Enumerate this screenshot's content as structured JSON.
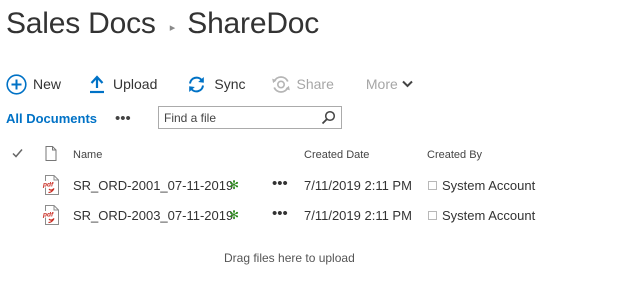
{
  "breadcrumb": {
    "site": "Sales Docs",
    "separator": "▸",
    "library": "ShareDoc"
  },
  "toolbar": {
    "new_label": "New",
    "upload_label": "Upload",
    "sync_label": "Sync",
    "share_label": "Share",
    "more_label": "More",
    "icons": [
      "plus-circle-icon",
      "upload-arrow-icon",
      "sync-icon",
      "share-icon",
      "chevron-down-icon"
    ],
    "accent_color": "#0072c6",
    "disabled_color": "#a6a6a6"
  },
  "view": {
    "current_view": "All Documents",
    "more_views": "•••"
  },
  "search": {
    "placeholder": "Find a file",
    "value": ""
  },
  "columns": {
    "check": "✓",
    "name": "Name",
    "created_date": "Created Date",
    "created_by": "Created By"
  },
  "documents": [
    {
      "name": "SR_ORD-2001_07-11-2019",
      "new_indicator": "✻",
      "menu": "•••",
      "created_date": "7/11/2019 2:11 PM",
      "created_by": "System Account",
      "file_type_icon": "pdf-file-icon"
    },
    {
      "name": "SR_ORD-2003_07-11-2019",
      "new_indicator": "✻",
      "menu": "•••",
      "created_date": "7/11/2019 2:11 PM",
      "created_by": "System Account",
      "file_type_icon": "pdf-file-icon"
    }
  ],
  "drop_zone": {
    "text": "Drag files here to upload"
  }
}
